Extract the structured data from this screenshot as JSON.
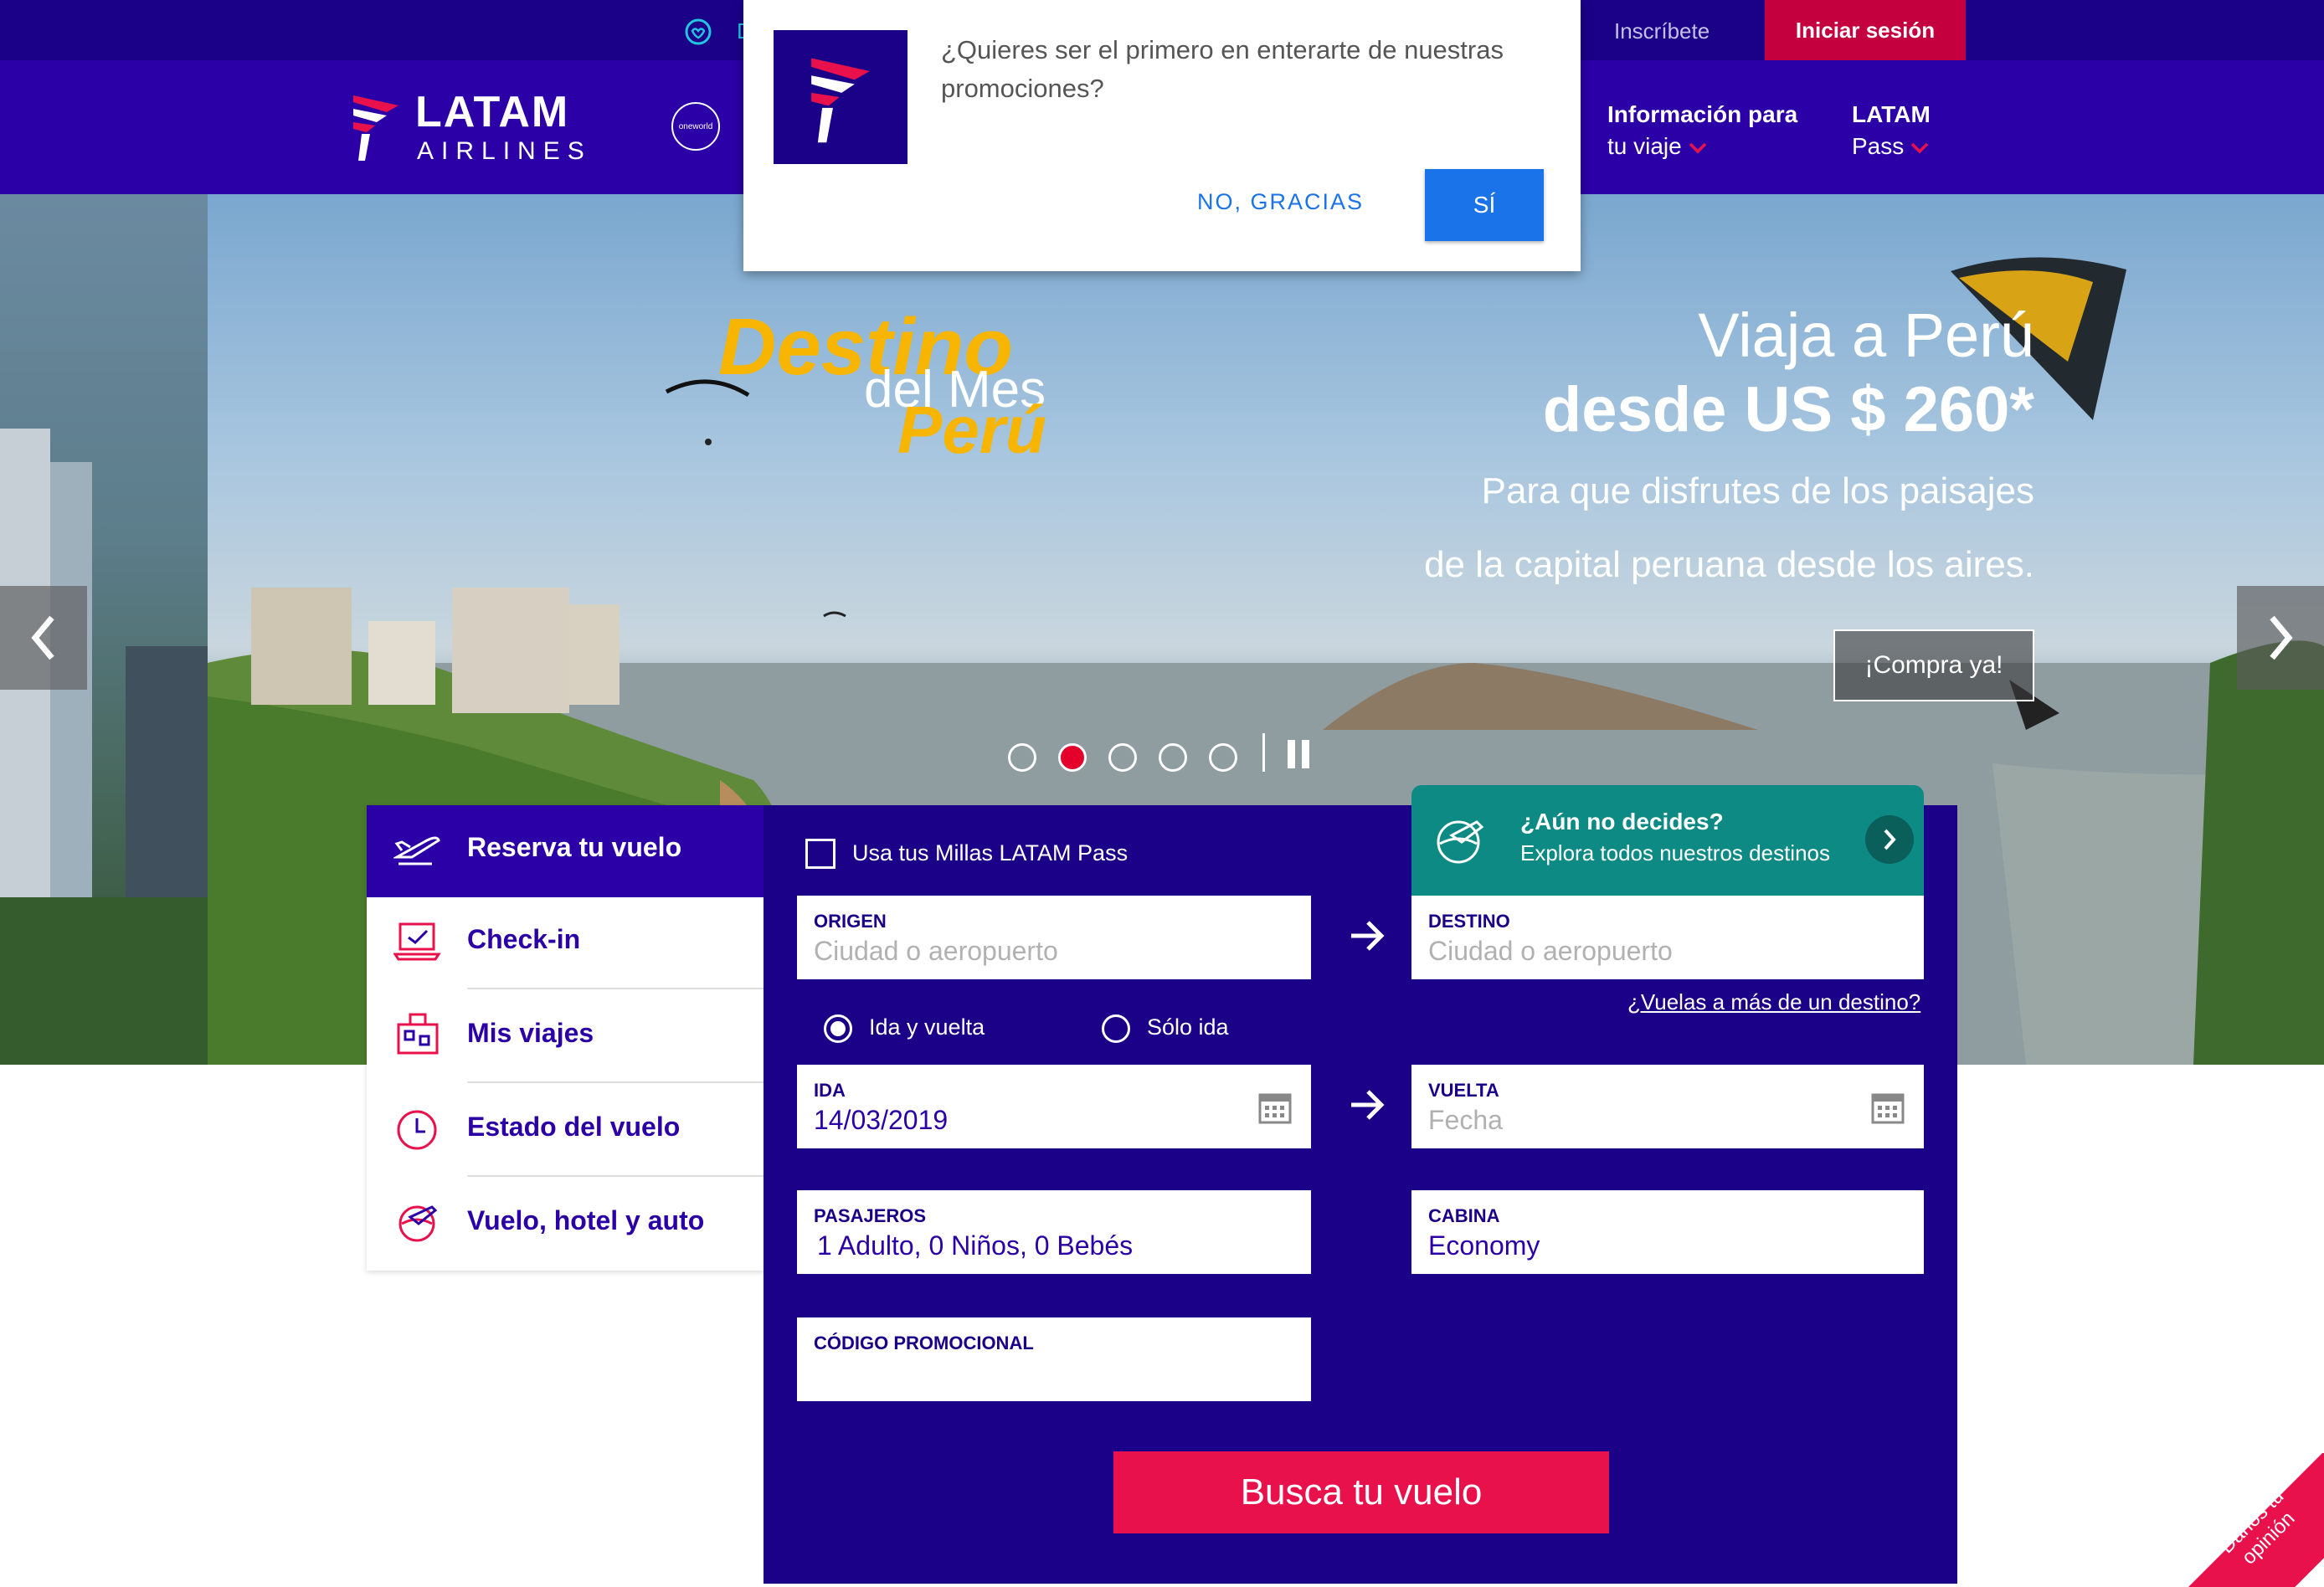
{
  "topbar": {
    "register_label": "Inscríbete",
    "login_label": "Iniciar sesión",
    "partial_label": "D"
  },
  "logo": {
    "brand": "LATAM",
    "sub": "AIRLINES",
    "alliance": "oneworld"
  },
  "nav": {
    "items": [
      {
        "line1": "Información para",
        "line2": "tu viaje"
      },
      {
        "line1": "LATAM",
        "line2": "Pass"
      }
    ]
  },
  "popup": {
    "message_line1": "¿Quieres ser el primero en enterarte de nuestras",
    "message_line2": "promociones?",
    "no_label": "NO, GRACIAS",
    "yes_label": "SÍ"
  },
  "hero": {
    "badge_line1": "Destino",
    "badge_line2": "del Mes",
    "badge_line3": "Perú",
    "title": "Viaja a Perú",
    "price": "desde US $ 260*",
    "desc_line1": "Para que disfrutes de los paisajes",
    "desc_line2": "de la capital peruana desde los aires.",
    "cta": "¡Compra ya!",
    "slide_count": 5,
    "active_slide": 2
  },
  "sidebar": {
    "items": [
      {
        "label": "Reserva tu vuelo",
        "icon": "plane-icon"
      },
      {
        "label": "Check-in",
        "icon": "laptop-check-icon"
      },
      {
        "label": "Mis viajes",
        "icon": "luggage-icon"
      },
      {
        "label": "Estado del vuelo",
        "icon": "clock-icon"
      },
      {
        "label": "Vuelo, hotel y auto",
        "icon": "globe-plane-icon"
      }
    ]
  },
  "form": {
    "miles_label": "Usa tus Millas LATAM Pass",
    "origin": {
      "label": "ORIGEN",
      "placeholder": "Ciudad o aeropuerto"
    },
    "destination": {
      "label": "DESTINO",
      "placeholder": "Ciudad o aeropuerto"
    },
    "multi_dest": "¿Vuelas a más de un destino?",
    "trip_roundtrip": "Ida y vuelta",
    "trip_oneway": "Sólo ida",
    "departure": {
      "label": "IDA",
      "value": "14/03/2019"
    },
    "return": {
      "label": "VUELTA",
      "placeholder": "Fecha"
    },
    "passengers": {
      "label": "PASAJEROS",
      "value": "1 Adulto, 0 Niños, 0 Bebés"
    },
    "cabin": {
      "label": "CABINA",
      "value": "Economy"
    },
    "promo": {
      "label": "CÓDIGO PROMOCIONAL",
      "value": ""
    },
    "search_label": "Busca tu vuelo"
  },
  "explore": {
    "title": "¿Aún no decides?",
    "subtitle": "Explora todos nuestros destinos"
  },
  "feedback": {
    "line1": "Danos tu",
    "line2": "opinión"
  },
  "colors": {
    "primary": "#1b0088",
    "nav": "#2b00a6",
    "accent": "#e8114b",
    "teal": "#0d8a83",
    "popup_blue": "#1a73e8"
  }
}
